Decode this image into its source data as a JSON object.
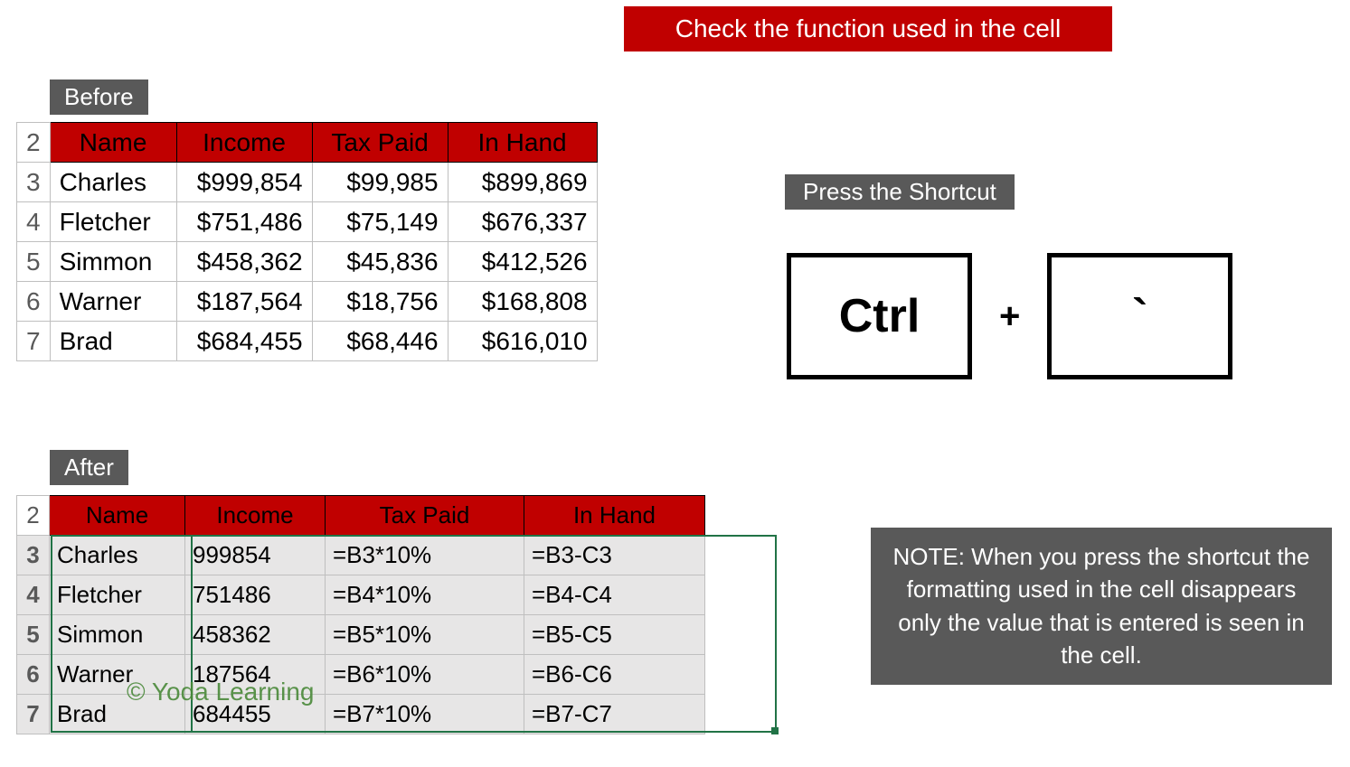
{
  "banner": "Check the function used in the cell",
  "labels": {
    "before": "Before",
    "after": "After",
    "shortcut": "Press the Shortcut"
  },
  "headers": [
    "Name",
    "Income",
    "Tax Paid",
    "In Hand"
  ],
  "before_rows": [
    {
      "rn": "2"
    },
    {
      "rn": "3",
      "name": "Charles",
      "income": "$999,854",
      "tax": "$99,985",
      "inhand": "$899,869"
    },
    {
      "rn": "4",
      "name": "Fletcher",
      "income": "$751,486",
      "tax": "$75,149",
      "inhand": "$676,337"
    },
    {
      "rn": "5",
      "name": "Simmon",
      "income": "$458,362",
      "tax": "$45,836",
      "inhand": "$412,526"
    },
    {
      "rn": "6",
      "name": "Warner",
      "income": "$187,564",
      "tax": "$18,756",
      "inhand": "$168,808"
    },
    {
      "rn": "7",
      "name": "Brad",
      "income": "$684,455",
      "tax": "$68,446",
      "inhand": "$616,010"
    }
  ],
  "after_rows": [
    {
      "rn": "2"
    },
    {
      "rn": "3",
      "name": "Charles",
      "income": "999854",
      "tax": "=B3*10%",
      "inhand": "=B3-C3"
    },
    {
      "rn": "4",
      "name": "Fletcher",
      "income": "751486",
      "tax": "=B4*10%",
      "inhand": "=B4-C4"
    },
    {
      "rn": "5",
      "name": "Simmon",
      "income": "458362",
      "tax": "=B5*10%",
      "inhand": "=B5-C5"
    },
    {
      "rn": "6",
      "name": "Warner",
      "income": "187564",
      "tax": "=B6*10%",
      "inhand": "=B6-C6"
    },
    {
      "rn": "7",
      "name": "Brad",
      "income": "684455",
      "tax": "=B7*10%",
      "inhand": "=B7-C7"
    }
  ],
  "keys": {
    "k1": "Ctrl",
    "plus": "+",
    "k2": "`"
  },
  "note": "NOTE: When you press the shortcut the formatting used in the cell disappears only the value that is entered is seen in the cell.",
  "watermark": "© Yoda Learning"
}
